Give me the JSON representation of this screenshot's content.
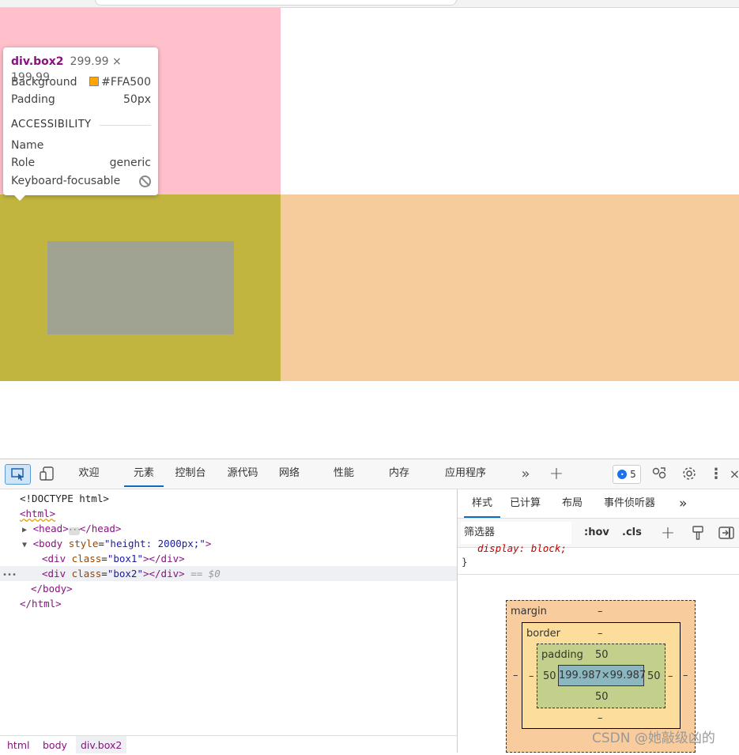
{
  "tooltip": {
    "tag": "div",
    "cls": ".box2",
    "dims": "299.99 × 199.99",
    "bg_label": "Background",
    "bg_value": "#FFA500",
    "padding_label": "Padding",
    "padding_value": "50px",
    "section": "ACCESSIBILITY",
    "name_label": "Name",
    "role_label": "Role",
    "role_value": "generic",
    "focus_label": "Keyboard-focusable",
    "focus_icon": "no-entry-icon"
  },
  "devtools": {
    "tabs": [
      "欢迎",
      "元素",
      "控制台",
      "源代码",
      "网络",
      "性能",
      "内存",
      "应用程序"
    ],
    "active_tab": "元素",
    "issues_count": "5"
  },
  "elements": {
    "doctype": "<!DOCTYPE html>",
    "html_open": "<html>",
    "head_open": "<head>",
    "head_ellipsis": "···",
    "head_close": "</head>",
    "body_tag_open": "<body",
    "body_attr": "style",
    "body_val": "\"height: 2000px;\"",
    "body_end": ">",
    "div_open": "<div",
    "class_attr": "class",
    "box1_val": "\"box1\"",
    "box2_val": "\"box2\"",
    "div_close": "></div>",
    "sel_marker": "== $0",
    "row_menu": "•••",
    "body_close": "</body>",
    "html_close": "</html>"
  },
  "breadcrumbs": [
    "html",
    "body",
    "div.box2"
  ],
  "styles": {
    "tabs": [
      "样式",
      "已计算",
      "布局",
      "事件侦听器"
    ],
    "active_tab": "样式",
    "filter_placeholder": "筛选器",
    "hov": ":hov",
    "cls": ".cls",
    "rule_line": "display: block;",
    "rule_close": "}"
  },
  "box_model": {
    "margin_label": "margin",
    "margin_top": "–",
    "margin_bottom": "–",
    "margin_left": "–",
    "margin_right": "–",
    "border_label": "border",
    "border_top": "–",
    "border_bottom": "–",
    "border_left": "–",
    "border_right": "–",
    "padding_label": "padding",
    "padding_top": "50",
    "padding_bottom": "50",
    "padding_left": "50",
    "padding_right": "50",
    "content": "199.987×99.987",
    "colors": {
      "margin": "#f9cc9d",
      "border": "#fddd9b",
      "padding": "#c3d08b",
      "content": "#8cb6c0"
    }
  },
  "page_colors": {
    "box_pink": "#ffc0cb",
    "box2": "#c1b43f",
    "box2_content": "#a0a391",
    "peach": "#f6cc9c"
  },
  "watermark": "CSDN @她敲级凶的"
}
